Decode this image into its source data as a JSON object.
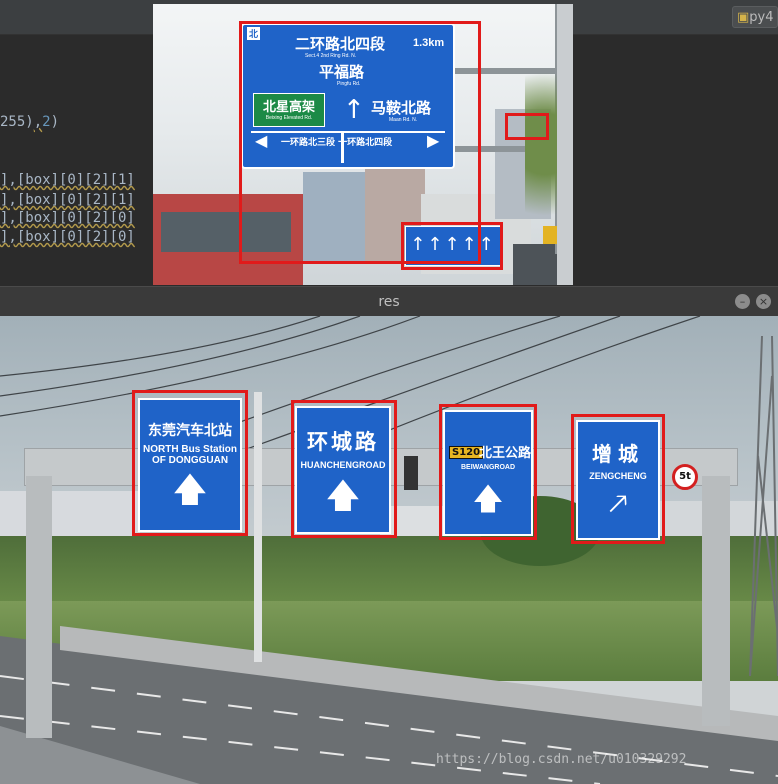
{
  "ide": {
    "tab_label": "py4",
    "code_lines": [
      {
        "prefix": "255)",
        "num": "2",
        "suffix": ")"
      },
      {
        "prefix": "],[box][0][2][1]"
      },
      {
        "prefix": "],[box][0][2][1]"
      },
      {
        "prefix": "],[box][0][2][0]"
      },
      {
        "prefix": "],[box][0][2][0]"
      }
    ]
  },
  "top_image": {
    "main_sign": {
      "corner": "北",
      "line1": "二环路北四段",
      "distance": "1.3km",
      "line1_en": "Sect.4 2nd Ring Rd. N.",
      "line2": "平福路",
      "line2_en": "Pingfu Rd.",
      "left_box": "北星高架",
      "left_box_en": "Beixing Elevated Rd.",
      "right_dest": "马鞍北路",
      "right_dest_en": "Maan Rd. N.",
      "bottom_bar": "一环路北三段 一环路北四段"
    }
  },
  "res_window": {
    "title": "res",
    "minimize": "–",
    "close": "×",
    "signs": [
      {
        "cn": "东莞汽车北站",
        "en1": "NORTH Bus Station",
        "en2": "OF DONGGUAN",
        "arrow": "up"
      },
      {
        "cn": "环城路",
        "en1": "HUANCHENGROAD",
        "en2": "",
        "arrow": "up"
      },
      {
        "code": "S120",
        "cn": "北王公路",
        "en1": "BEIWANGROAD",
        "en2": "",
        "arrow": "up"
      },
      {
        "cn": "增城",
        "en1": "ZENGCHENG",
        "en2": "",
        "arrow": "up-right"
      }
    ],
    "speed_sign": "5t",
    "watermark": "https://blog.csdn.net/u010329292"
  },
  "colors": {
    "sign_blue": "#1f63c8",
    "box_red": "#e11a1a",
    "ide_bg": "#2b2b2b"
  }
}
